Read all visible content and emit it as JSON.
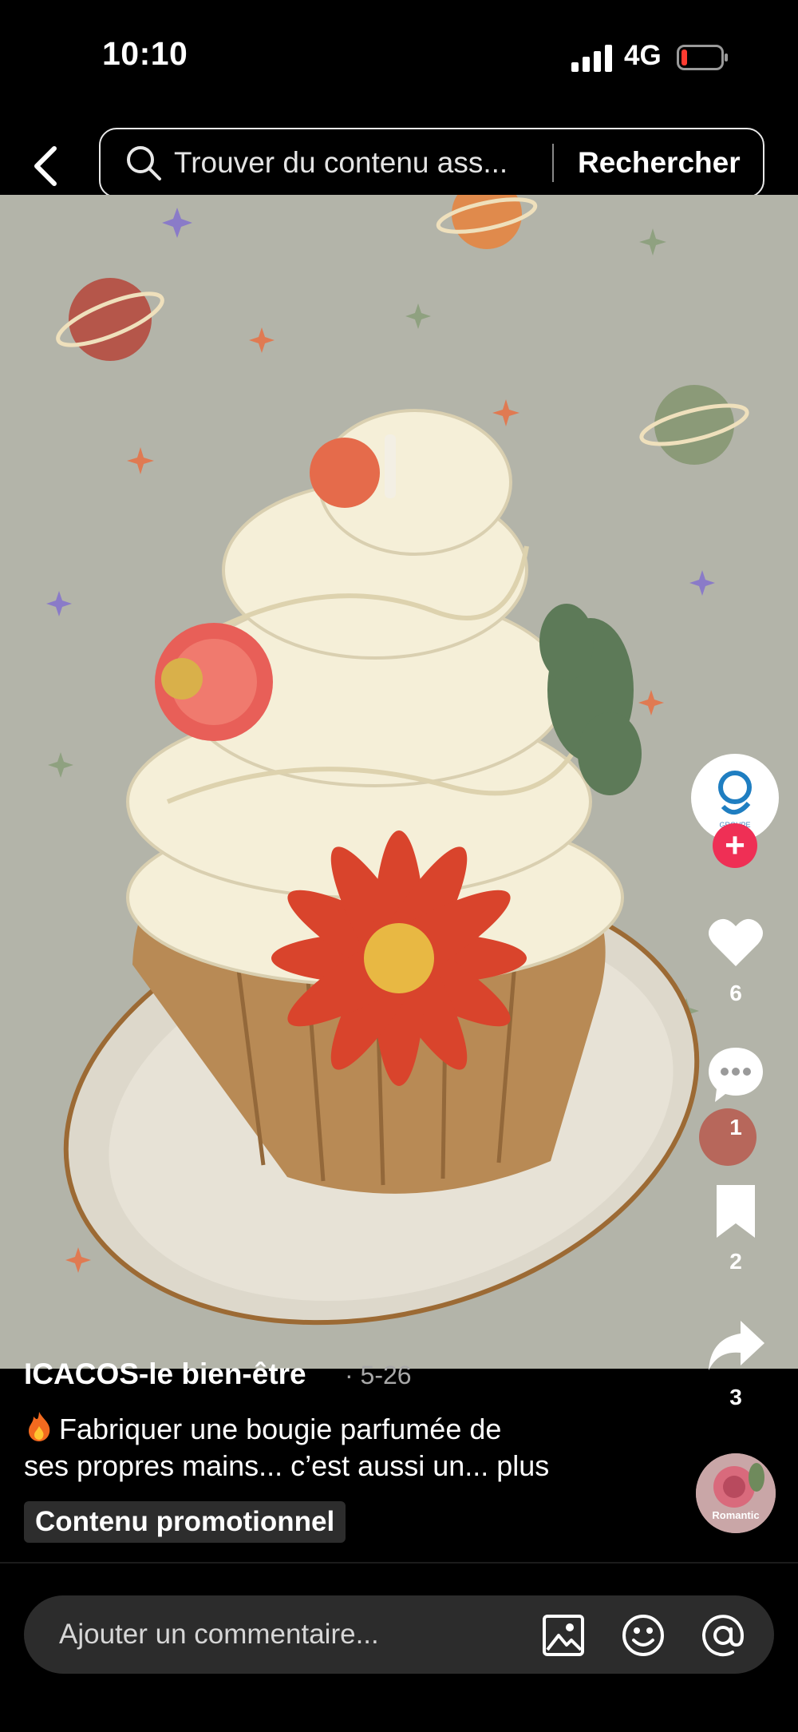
{
  "status_bar": {
    "time": "10:10",
    "network": "4G"
  },
  "search": {
    "placeholder": "Trouver du contenu ass...",
    "button": "Rechercher"
  },
  "rail": {
    "likes": "6",
    "comments": "1",
    "saves": "2",
    "shares": "3",
    "follow_symbol": "+",
    "avatar_text": "GROUPE",
    "music_label": "Romantic"
  },
  "post": {
    "author": "ICACOS-le bien-être",
    "date": "· 5-26",
    "caption_line1": "Fabriquer une bougie parfumée de",
    "caption_line2": "ses propres mains... c’est aussi un...",
    "more": "plus",
    "promo": "Contenu promotionnel"
  },
  "comment": {
    "placeholder": "Ajouter un commentaire..."
  },
  "colors": {
    "follow_red": "#ef2f55",
    "background_photo": "#b3b4a9"
  }
}
